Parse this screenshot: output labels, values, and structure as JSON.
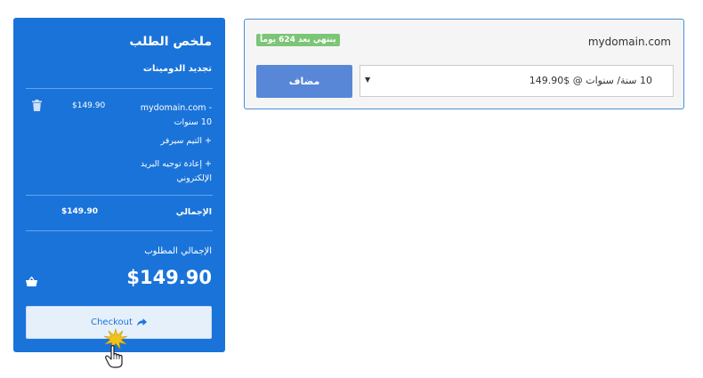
{
  "domain_card": {
    "domain": "mydomain.com",
    "expiry_badge": "ينتهي بعد 624 يوماً",
    "period_selected": "10 سنة/ سنوات @ $149.90",
    "added_label": "مضاف"
  },
  "summary": {
    "title": "ملخص الطلب",
    "subtitle": "تجديد الدومينات",
    "item": {
      "desc": "mydomain.com - 10 سنوات",
      "price": "$149.90"
    },
    "addons": [
      "+ التيم سيرفر",
      "+ إعادة توجيه البريد الإلكتروني"
    ],
    "total_label": "الإجمالي",
    "total_value": "$149.90",
    "due_label": "الإجمالي المطلوب",
    "due_value": "$149.90",
    "checkout_label": "Checkout"
  },
  "colors": {
    "panel": "#1a73d9",
    "added_button": "#5887d8",
    "badge": "#7cc576",
    "card_border": "#4a90d9"
  },
  "icons": [
    "trash-icon",
    "basket-icon",
    "share-arrow-icon",
    "hand-cursor-icon",
    "dropdown-arrow-icon"
  ]
}
